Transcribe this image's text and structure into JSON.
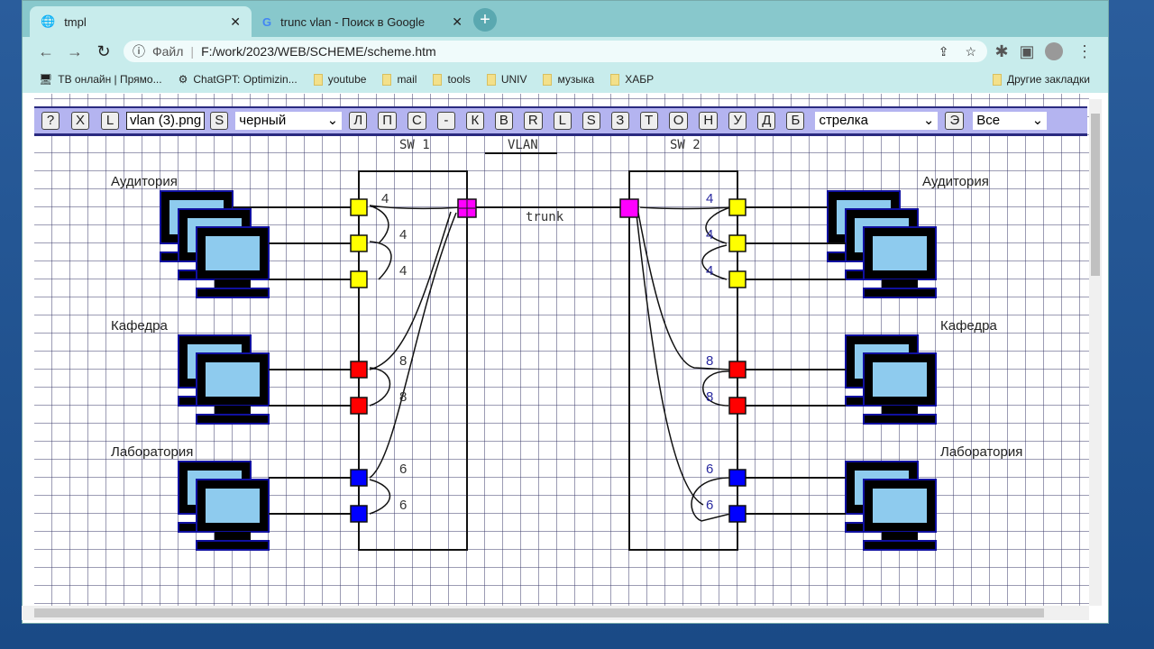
{
  "browser": {
    "tabs": [
      {
        "title": "tmpl",
        "active": true
      },
      {
        "title": "trunc vlan - Поиск в Google",
        "active": false
      }
    ],
    "address": {
      "scheme_label": "Файл",
      "url": "F:/work/2023/WEB/SCHEME/scheme.htm"
    },
    "bookmarks": [
      "ТВ онлайн | Прямо...",
      "ChatGPT: Optimizin...",
      "youtube",
      "mail",
      "tools",
      "UNIV",
      "музыка",
      "ХАБР"
    ],
    "other_bookmarks": "Другие закладки"
  },
  "toolbar": {
    "help": "?",
    "close": "X",
    "load": "L",
    "file": "vlan (3).png",
    "save": "S",
    "color": "черный",
    "buttons": [
      "Л",
      "П",
      "С",
      "-",
      "К",
      "В",
      "R",
      "L",
      "S",
      "З",
      "Т",
      "О",
      "Н",
      "У",
      "Д",
      "Б"
    ],
    "tool": "стрелка",
    "e": "Э",
    "filter": "Все"
  },
  "diagram": {
    "sw1": "SW 1",
    "vlan": "VLAN",
    "sw2": "SW 2",
    "trunk": "trunk",
    "left_groups": [
      "Аудитория",
      "Кафедра",
      "Лаборатория"
    ],
    "right_groups": [
      "Аудитория",
      "Кафедра",
      "Лаборатория"
    ],
    "port_vlans": [
      "4",
      "4",
      "4",
      "8",
      "8",
      "6",
      "6"
    ],
    "colors": {
      "vlan4": "#ffff00",
      "vlan8": "#ff0000",
      "vlan6": "#0000ff",
      "trunk": "#ff00ff"
    }
  }
}
